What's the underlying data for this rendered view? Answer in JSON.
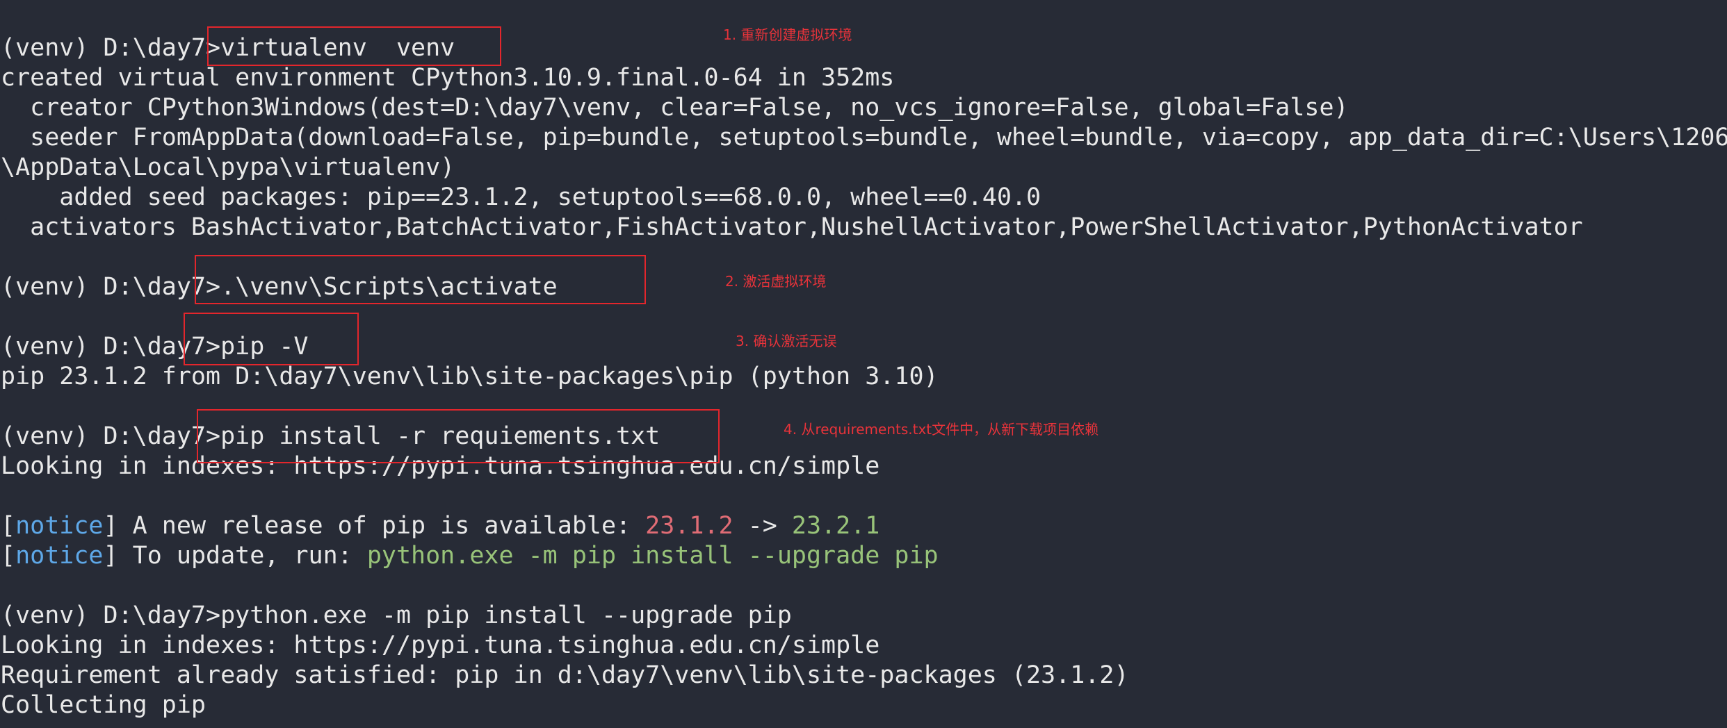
{
  "terminal": {
    "lines": [
      [
        {
          "text": "(venv) D:\\day7>virtualenv  venv",
          "style": "plain"
        }
      ],
      [
        {
          "text": "created virtual environment CPython3.10.9.final.0-64 in 352ms",
          "style": "plain"
        }
      ],
      [
        {
          "text": "  creator CPython3Windows(dest=D:\\day7\\venv, clear=False, no_vcs_ignore=False, global=False)",
          "style": "plain"
        }
      ],
      [
        {
          "text": "  seeder FromAppData(download=False, pip=bundle, setuptools=bundle, wheel=bundle, via=copy, app_data_dir=C:\\Users\\1206",
          "style": "plain"
        }
      ],
      [
        {
          "text": "\\AppData\\Local\\pypa\\virtualenv)",
          "style": "plain"
        }
      ],
      [
        {
          "text": "    added seed packages: pip==23.1.2, setuptools==68.0.0, wheel==0.40.0",
          "style": "plain"
        }
      ],
      [
        {
          "text": "  activators BashActivator,BatchActivator,FishActivator,NushellActivator,PowerShellActivator,PythonActivator",
          "style": "plain"
        }
      ],
      [
        {
          "text": "",
          "style": "plain"
        }
      ],
      [
        {
          "text": "(venv) D:\\day7>.\\venv\\Scripts\\activate",
          "style": "plain"
        }
      ],
      [
        {
          "text": "",
          "style": "plain"
        }
      ],
      [
        {
          "text": "(venv) D:\\day7>pip -V",
          "style": "plain"
        }
      ],
      [
        {
          "text": "pip 23.1.2 from D:\\day7\\venv\\lib\\site-packages\\pip (python 3.10)",
          "style": "plain"
        }
      ],
      [
        {
          "text": "",
          "style": "plain"
        }
      ],
      [
        {
          "text": "(venv) D:\\day7>pip install -r requiements.txt",
          "style": "plain"
        }
      ],
      [
        {
          "text": "Looking in indexes: https://pypi.tuna.tsinghua.edu.cn/simple",
          "style": "plain"
        }
      ],
      [
        {
          "text": "",
          "style": "plain"
        }
      ],
      [
        {
          "text": "[",
          "style": "plain"
        },
        {
          "text": "notice",
          "style": "notice"
        },
        {
          "text": "] A new release of pip is available: ",
          "style": "plain"
        },
        {
          "text": "23.1.2",
          "style": "red"
        },
        {
          "text": " -> ",
          "style": "plain"
        },
        {
          "text": "23.2.1",
          "style": "green"
        }
      ],
      [
        {
          "text": "[",
          "style": "plain"
        },
        {
          "text": "notice",
          "style": "notice"
        },
        {
          "text": "] To update, run: ",
          "style": "plain"
        },
        {
          "text": "python.exe -m pip install --upgrade pip",
          "style": "green"
        }
      ],
      [
        {
          "text": "",
          "style": "plain"
        }
      ],
      [
        {
          "text": "(venv) D:\\day7>python.exe -m pip install --upgrade pip",
          "style": "plain"
        }
      ],
      [
        {
          "text": "Looking in indexes: https://pypi.tuna.tsinghua.edu.cn/simple",
          "style": "plain"
        }
      ],
      [
        {
          "text": "Requirement already satisfied: pip in d:\\day7\\venv\\lib\\site-packages (23.1.2)",
          "style": "plain"
        }
      ],
      [
        {
          "text": "Collecting pip",
          "style": "plain"
        }
      ]
    ]
  },
  "annotations": {
    "step1": "1. 重新创建虚拟环境",
    "step2": "2. 激活虚拟环境",
    "step3": "3. 确认激活无误",
    "step4": "4. 从requirements.txt文件中，从新下载项目依赖"
  },
  "colors": {
    "background": "#272b36",
    "text": "#e8e8e8",
    "notice": "#5ea8e8",
    "version_old": "#e06c75",
    "version_new": "#98c379",
    "annotation": "#e3262c"
  }
}
